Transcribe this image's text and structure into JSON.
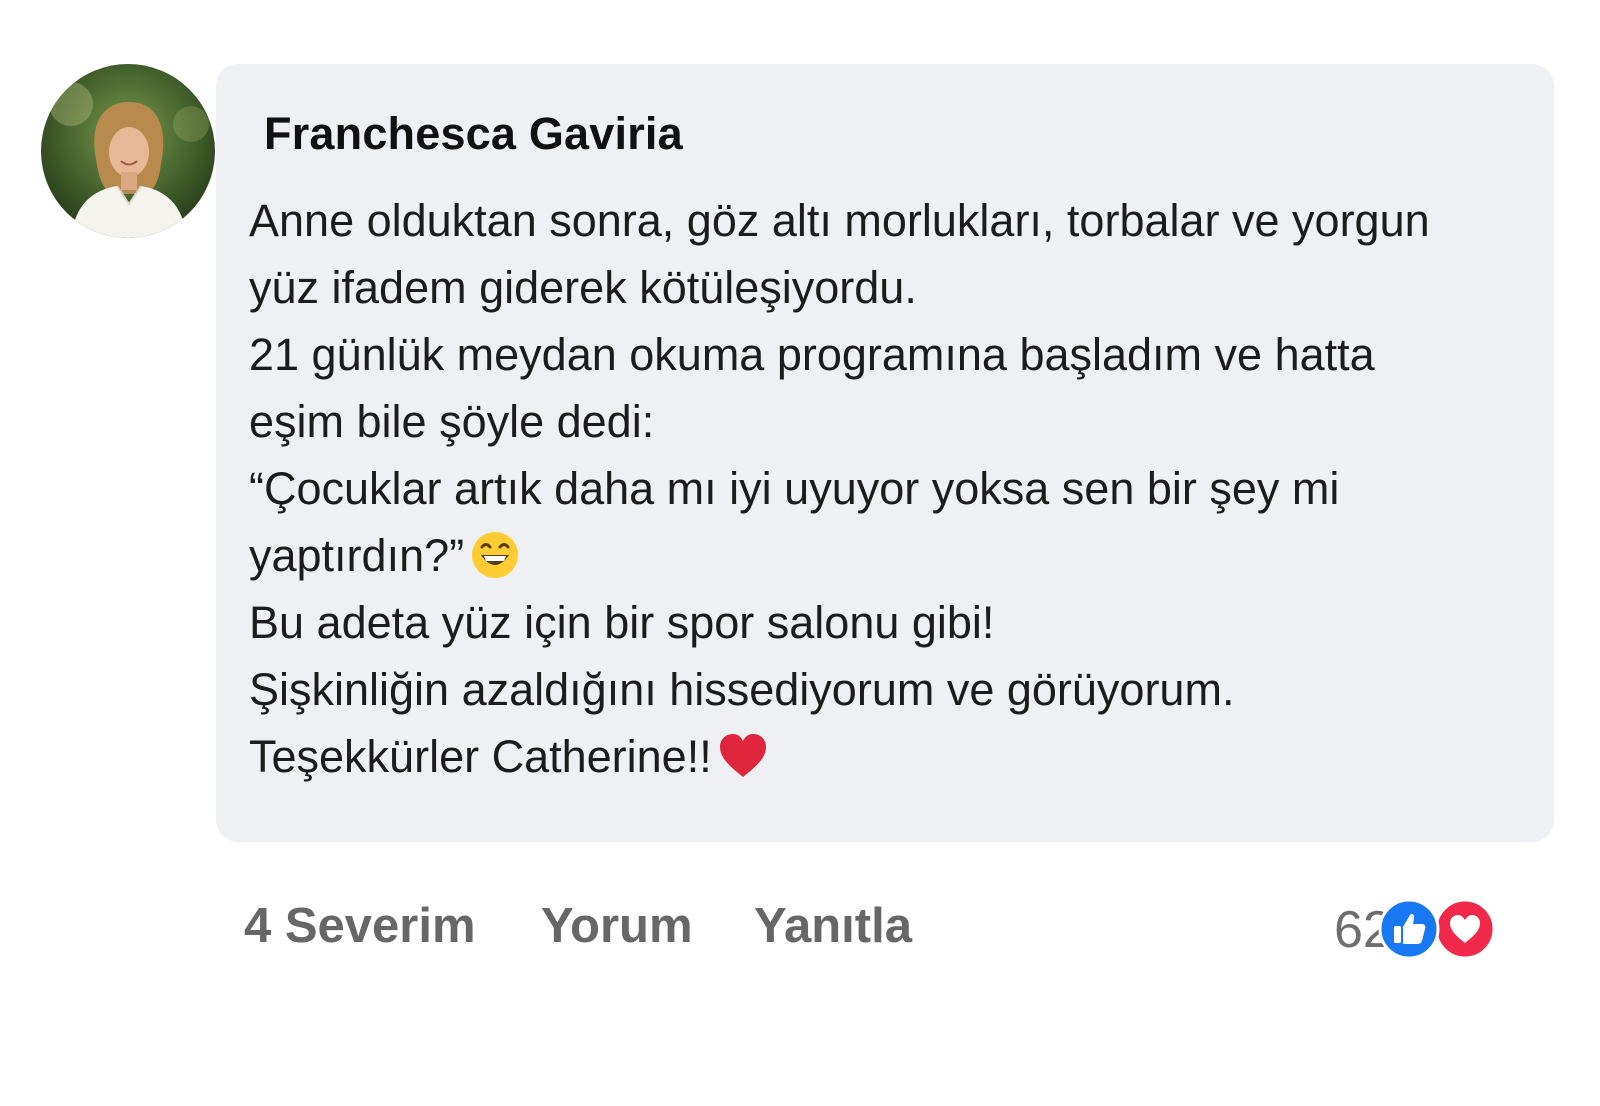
{
  "post": {
    "author": "Franchesca Gaviria",
    "body_lines": [
      "Anne olduktan sonra, göz altı morlukları, torbalar ve yorgun",
      "yüz ifadem giderek kötüleşiyordu.",
      "21 günlük meydan okuma programına başladım ve hatta",
      "eşim bile şöyle dedi:",
      "“Çocuklar artık daha mı iyi uyuyor yoksa sen bir şey mi",
      "yaptırdın?”",
      "Bu adeta yüz için bir spor salonu gibi!",
      "Şişkinliğin azaldığını hissediyorum ve görüyorum.",
      "Teşekkürler Catherine!!"
    ],
    "emojis": {
      "line_6": "grinning-face-icon",
      "line_9": "red-heart-icon"
    }
  },
  "actions": {
    "like": "4 Severim",
    "comment": "Yorum",
    "reply": "Yanıtla"
  },
  "reactions": {
    "count": "62",
    "icons": [
      "like-reaction-icon",
      "love-reaction-icon"
    ],
    "colors": {
      "like": "#1877f2",
      "love": "#f02849"
    }
  },
  "colors": {
    "bubble_bg": "#eff0f3",
    "action_text": "#676767"
  }
}
